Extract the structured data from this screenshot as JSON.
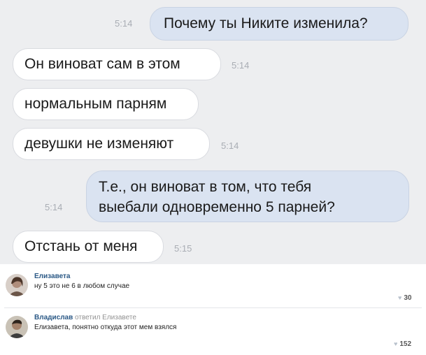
{
  "messages": [
    {
      "text": "Почему ты Никите изменила?",
      "time": "5:14",
      "side": "out"
    },
    {
      "text": "Он виноват сам в этом",
      "time": "5:14",
      "side": "in"
    },
    {
      "text": "нормальным парням",
      "time": "",
      "side": "in"
    },
    {
      "text": "девушки не изменяют",
      "time": "5:14",
      "side": "in"
    },
    {
      "lines": [
        "Т.е., он виноват в том, что тебя",
        "выебали одновременно 5 парней?"
      ],
      "time": "5:14",
      "side": "out"
    },
    {
      "text": "Отстань от меня",
      "time": "5:15",
      "side": "in"
    }
  ],
  "comments": [
    {
      "author": "Елизавета",
      "reply_to": "",
      "text": "ну 5 это не 6 в любом случае",
      "likes": "30"
    },
    {
      "author": "Владислав",
      "reply_to": "ответил Елизавете",
      "text": "Елизавета, понятно откуда этот мем взялся",
      "likes": "152"
    }
  ],
  "icons": {
    "like": "heart-icon"
  }
}
